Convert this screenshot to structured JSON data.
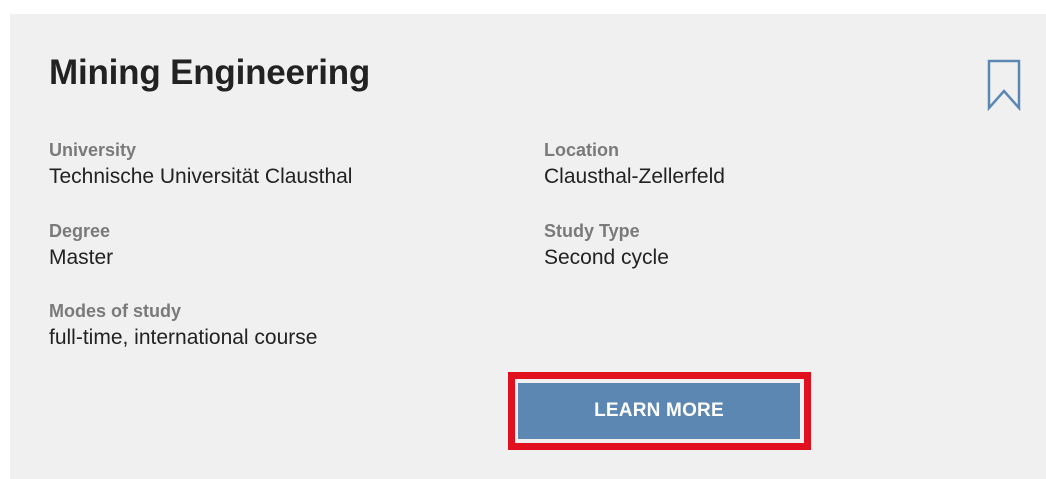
{
  "program": {
    "title": "Mining Engineering",
    "bookmark_icon": "bookmark-icon",
    "fields": {
      "university": {
        "label": "University",
        "value": "Technische Universität Clausthal"
      },
      "location": {
        "label": "Location",
        "value": "Clausthal-Zellerfeld"
      },
      "degree": {
        "label": "Degree",
        "value": "Master"
      },
      "study_type": {
        "label": "Study Type",
        "value": "Second cycle"
      },
      "modes_of_study": {
        "label": "Modes of study",
        "value": "full-time, international course"
      }
    },
    "learn_more_label": "LEARN MORE"
  },
  "colors": {
    "card_background": "#f0f0f0",
    "button": "#5b87b2",
    "highlight": "#e0101e",
    "bookmark": "#5b87b2"
  }
}
